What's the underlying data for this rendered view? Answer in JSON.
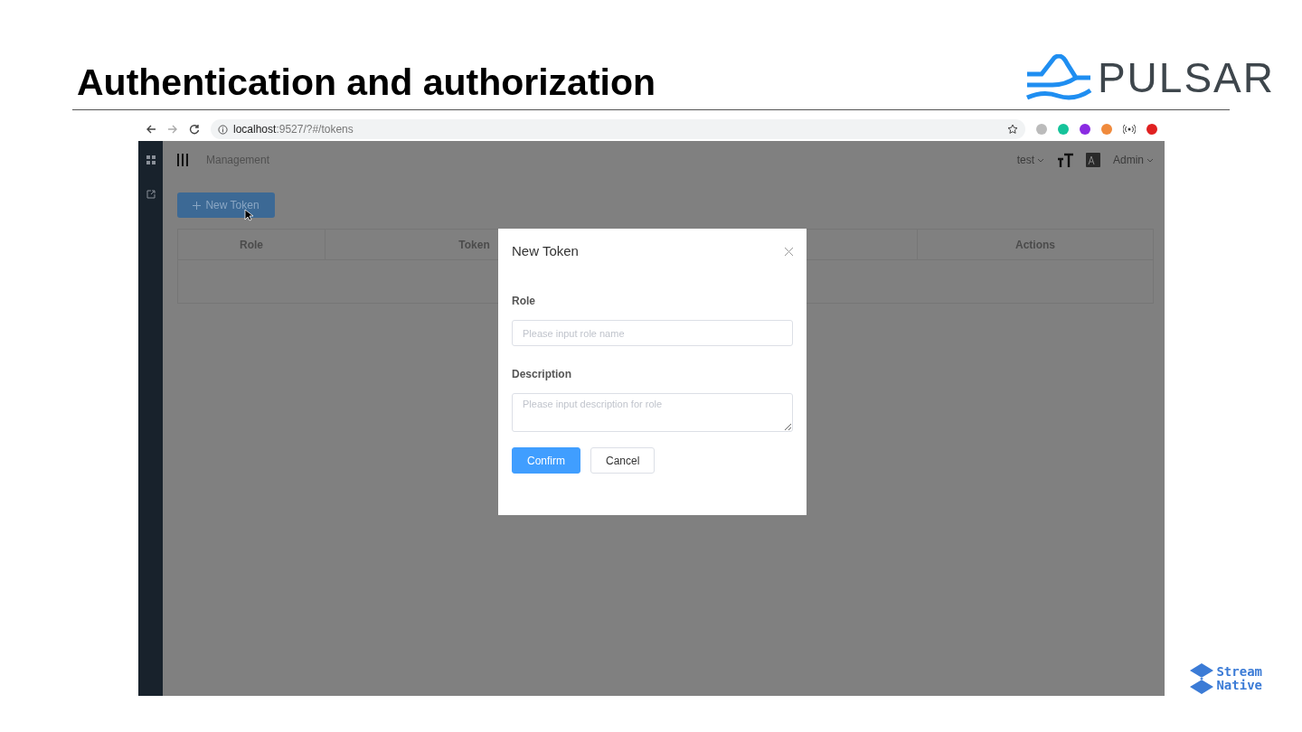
{
  "slide": {
    "title": "Authentication and authorization",
    "logo_text": "PULSAR",
    "footer_logo": [
      "Stream",
      "Native"
    ]
  },
  "browser": {
    "url_host": "localhost",
    "url_rest": ":9527/?#/tokens"
  },
  "app": {
    "breadcrumb": "Management",
    "cluster": "test",
    "user": "Admin",
    "new_button": "New Token",
    "table": {
      "columns": [
        "Role",
        "Token",
        "Actions"
      ]
    }
  },
  "dialog": {
    "title": "New Token",
    "fields": [
      {
        "kind": "input",
        "label": "Role",
        "placeholder": "Please input role name"
      },
      {
        "kind": "textarea",
        "label": "Description",
        "placeholder": "Please input description for role"
      }
    ],
    "buttons": [
      {
        "kind": "primary",
        "label": "Confirm"
      },
      {
        "kind": "default",
        "label": "Cancel"
      }
    ]
  }
}
